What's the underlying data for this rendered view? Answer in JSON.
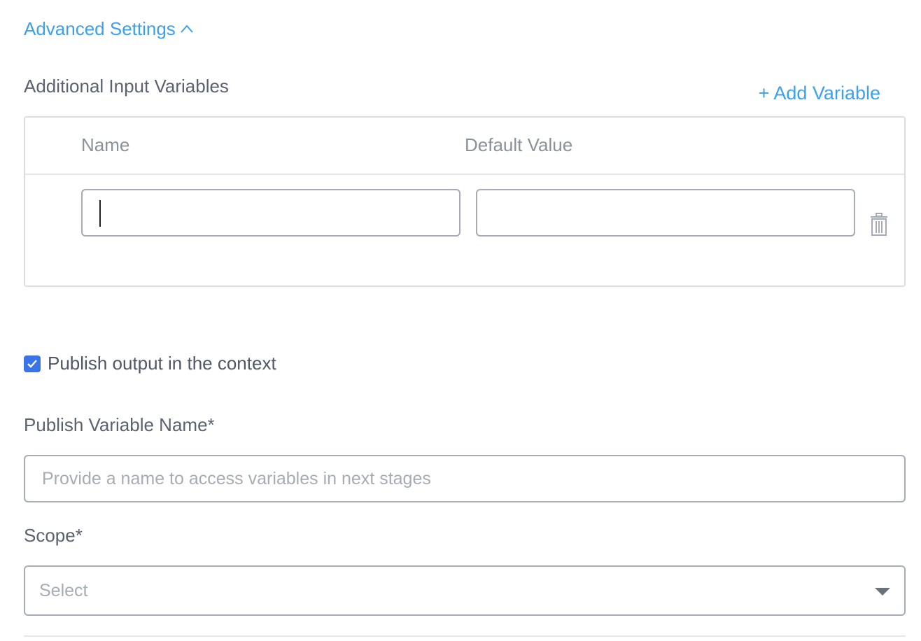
{
  "advanced_settings": {
    "label": "Advanced Settings",
    "expanded": true
  },
  "input_variables": {
    "section_label": "Additional Input Variables",
    "add_label": "+ Add Variable",
    "columns": {
      "name": "Name",
      "default_value": "Default Value"
    },
    "rows": [
      {
        "name": "",
        "default_value": ""
      }
    ]
  },
  "publish_output": {
    "label": "Publish output in the context",
    "checked": true
  },
  "publish_variable_name": {
    "label": "Publish Variable Name*",
    "value": "",
    "placeholder": "Provide a name to access variables in next stages"
  },
  "scope": {
    "label": "Scope*",
    "selected": "Select"
  },
  "colors": {
    "link": "#3aa2ea",
    "checkbox": "#3a74e8"
  },
  "icons": {
    "toggle": "chevron-up-icon",
    "delete": "trash-icon",
    "check": "checkmark-icon",
    "dropdown": "caret-down-icon"
  }
}
